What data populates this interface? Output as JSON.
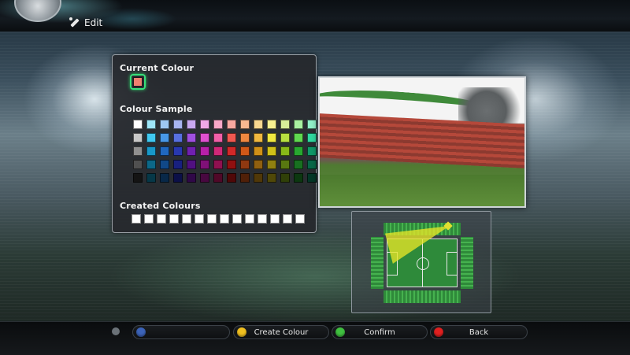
{
  "header": {
    "title": "Edit"
  },
  "colour_panel": {
    "current_label": "Current Colour",
    "current_colour": "#f08070",
    "sample_label": "Colour Sample",
    "sample_rows": [
      [
        "#ffffff",
        "#9ee6f8",
        "#9ec8f2",
        "#a8b4f0",
        "#c8a8f0",
        "#f0a8e8",
        "#f8a8c8",
        "#f8a8a0",
        "#f8b890",
        "#f8d890",
        "#f8f090",
        "#d8f098",
        "#a8f0a0",
        "#90f0c8"
      ],
      [
        "#c8c8c8",
        "#40c8f0",
        "#4898e8",
        "#5870e0",
        "#a050e0",
        "#e050d0",
        "#f060a8",
        "#f05850",
        "#f08840",
        "#f0b840",
        "#f0e840",
        "#b8e040",
        "#60d850",
        "#30d8a0"
      ],
      [
        "#909090",
        "#1898c8",
        "#2068c0",
        "#2838b0",
        "#7020b0",
        "#b820a8",
        "#d02878",
        "#d02828",
        "#d05818",
        "#d09018",
        "#d0c018",
        "#88b818",
        "#28a830",
        "#109868"
      ],
      [
        "#505050",
        "#0c6888",
        "#104888",
        "#182080",
        "#501080",
        "#801078",
        "#901050",
        "#901010",
        "#903810",
        "#906010",
        "#908010",
        "#587810",
        "#187020",
        "#086848"
      ],
      [
        "#141414",
        "#063848",
        "#082848",
        "#0c1048",
        "#300848",
        "#480840",
        "#500828",
        "#500808",
        "#502008",
        "#503808",
        "#504808",
        "#304008",
        "#0c3810",
        "#043828"
      ]
    ],
    "created_label": "Created Colours",
    "created_colours": [
      "#ffffff",
      "#ffffff",
      "#ffffff",
      "#ffffff",
      "#ffffff",
      "#ffffff",
      "#ffffff",
      "#ffffff",
      "#ffffff",
      "#ffffff",
      "#ffffff",
      "#ffffff",
      "#ffffff",
      "#ffffff"
    ]
  },
  "controls": {
    "dpad_label": "",
    "create_label": "Create Colour",
    "create_button_color": "#f0c020",
    "confirm_label": "Confirm",
    "confirm_button_color": "#40c040",
    "back_label": "Back",
    "back_button_color": "#e02020"
  }
}
